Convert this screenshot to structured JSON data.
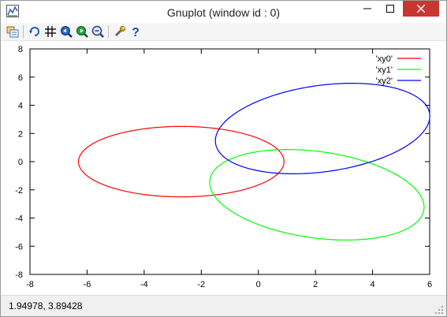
{
  "window": {
    "title": "Gnuplot (window id : 0)"
  },
  "toolbar": {
    "buttons": [
      {
        "icon": "copy-print-icon"
      },
      {
        "icon": "replot-icon"
      },
      {
        "icon": "grid-icon"
      },
      {
        "icon": "zoom-previous-icon"
      },
      {
        "icon": "zoom-next-icon"
      },
      {
        "icon": "zoom-unzoom-icon"
      },
      {
        "icon": "options-wrench-icon"
      },
      {
        "icon": "help-icon"
      }
    ]
  },
  "status": {
    "coords": "1.94978,  3.89428"
  },
  "colors": {
    "xy0": "#ff0000",
    "xy1": "#00ff00",
    "xy2": "#0000ff",
    "close_button": "#c7372f"
  },
  "chart_data": {
    "type": "line",
    "xlim": [
      -8,
      6
    ],
    "ylim": [
      -8,
      8
    ],
    "x_ticks": [
      -8,
      -6,
      -4,
      -2,
      0,
      2,
      4,
      6
    ],
    "y_ticks": [
      -8,
      -6,
      -4,
      -2,
      0,
      2,
      4,
      6,
      8
    ],
    "x_tick_labels": [
      "-8",
      "-6",
      "-4",
      "-2",
      "0",
      "2",
      "4",
      "6"
    ],
    "y_tick_labels": [
      "-8",
      "-6",
      "-4",
      "-2",
      "0",
      "2",
      "4",
      "6",
      "8"
    ],
    "grid": false,
    "legend_position": "top-right",
    "series": [
      {
        "name": "'xy0'",
        "shape": "ellipse",
        "center": [
          -2.7,
          0.0
        ],
        "semi_axis_x": 3.6,
        "semi_axis_y": 2.5,
        "rotation_deg": 0
      },
      {
        "name": "'xy1'",
        "shape": "ellipse",
        "center": [
          2.05,
          -2.35
        ],
        "semi_axis_x": 4.0,
        "semi_axis_y": 2.9,
        "rotation_deg": -30
      },
      {
        "name": "'xy2'",
        "shape": "ellipse",
        "center": [
          2.25,
          2.35
        ],
        "semi_axis_x": 4.0,
        "semi_axis_y": 2.9,
        "rotation_deg": 30
      }
    ]
  }
}
